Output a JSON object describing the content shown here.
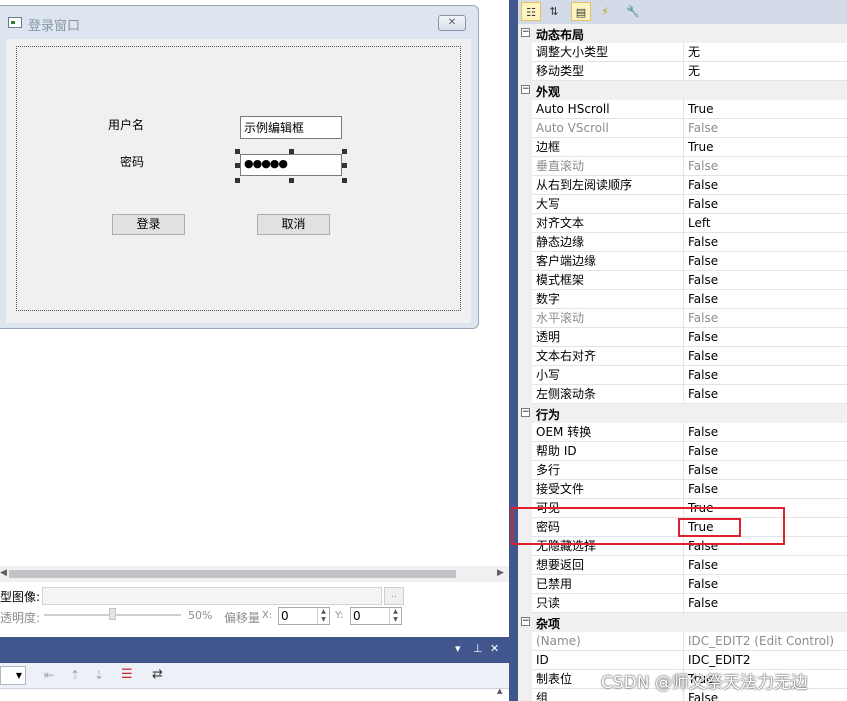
{
  "dialog": {
    "title": "登录窗口",
    "close_glyph": "✕",
    "username_label": "用户名",
    "username_value": "示例编辑框",
    "password_label": "密码",
    "password_value": "●●●●●",
    "login_button": "登录",
    "cancel_button": "取消"
  },
  "lower_panel": {
    "image_label": "型图像:",
    "browse_button": "..",
    "transparency_label": "透明度:",
    "transparency_value": "50%",
    "offset_label": "偏移量",
    "x_label": "X:",
    "x_value": "0",
    "y_label": "Y:",
    "y_value": "0"
  },
  "toolwindow": {
    "dropdown_glyph": "▾",
    "pin_glyph": "⊥",
    "close_glyph": "✕"
  },
  "property_grid": {
    "categories": [
      {
        "name": "动态布局",
        "props": [
          {
            "name": "调整大小类型",
            "value": "无",
            "disabled": false
          },
          {
            "name": "移动类型",
            "value": "无",
            "disabled": false
          }
        ]
      },
      {
        "name": "外观",
        "props": [
          {
            "name": "Auto HScroll",
            "value": "True",
            "disabled": false
          },
          {
            "name": "Auto VScroll",
            "value": "False",
            "disabled": true
          },
          {
            "name": "边框",
            "value": "True",
            "disabled": false
          },
          {
            "name": "垂直滚动",
            "value": "False",
            "disabled": true
          },
          {
            "name": "从右到左阅读顺序",
            "value": "False",
            "disabled": false
          },
          {
            "name": "大写",
            "value": "False",
            "disabled": false
          },
          {
            "name": "对齐文本",
            "value": "Left",
            "disabled": false
          },
          {
            "name": "静态边缘",
            "value": "False",
            "disabled": false
          },
          {
            "name": "客户端边缘",
            "value": "False",
            "disabled": false
          },
          {
            "name": "模式框架",
            "value": "False",
            "disabled": false
          },
          {
            "name": "数字",
            "value": "False",
            "disabled": false
          },
          {
            "name": "水平滚动",
            "value": "False",
            "disabled": true
          },
          {
            "name": "透明",
            "value": "False",
            "disabled": false
          },
          {
            "name": "文本右对齐",
            "value": "False",
            "disabled": false
          },
          {
            "name": "小写",
            "value": "False",
            "disabled": false
          },
          {
            "name": "左侧滚动条",
            "value": "False",
            "disabled": false
          }
        ]
      },
      {
        "name": "行为",
        "props": [
          {
            "name": "OEM 转换",
            "value": "False",
            "disabled": false
          },
          {
            "name": "帮助 ID",
            "value": "False",
            "disabled": false
          },
          {
            "name": "多行",
            "value": "False",
            "disabled": false
          },
          {
            "name": "接受文件",
            "value": "False",
            "disabled": false
          },
          {
            "name": "可见",
            "value": "True",
            "disabled": false
          },
          {
            "name": "密码",
            "value": "True",
            "disabled": false
          },
          {
            "name": "无隐藏选择",
            "value": "False",
            "disabled": false
          },
          {
            "name": "想要返回",
            "value": "False",
            "disabled": false
          },
          {
            "name": "已禁用",
            "value": "False",
            "disabled": false
          },
          {
            "name": "只读",
            "value": "False",
            "disabled": false
          }
        ]
      },
      {
        "name": "杂项",
        "props": [
          {
            "name": "(Name)",
            "value": "IDC_EDIT2 (Edit Control)",
            "disabled": true
          },
          {
            "name": "ID",
            "value": "IDC_EDIT2",
            "disabled": false
          },
          {
            "name": "制表位",
            "value": "True",
            "disabled": false
          },
          {
            "name": "组",
            "value": "False",
            "disabled": false
          }
        ]
      }
    ]
  },
  "watermark": "CSDN @师父祭天法力无边",
  "colors": {
    "accent": "#40568d",
    "highlight": "#e0202e"
  }
}
